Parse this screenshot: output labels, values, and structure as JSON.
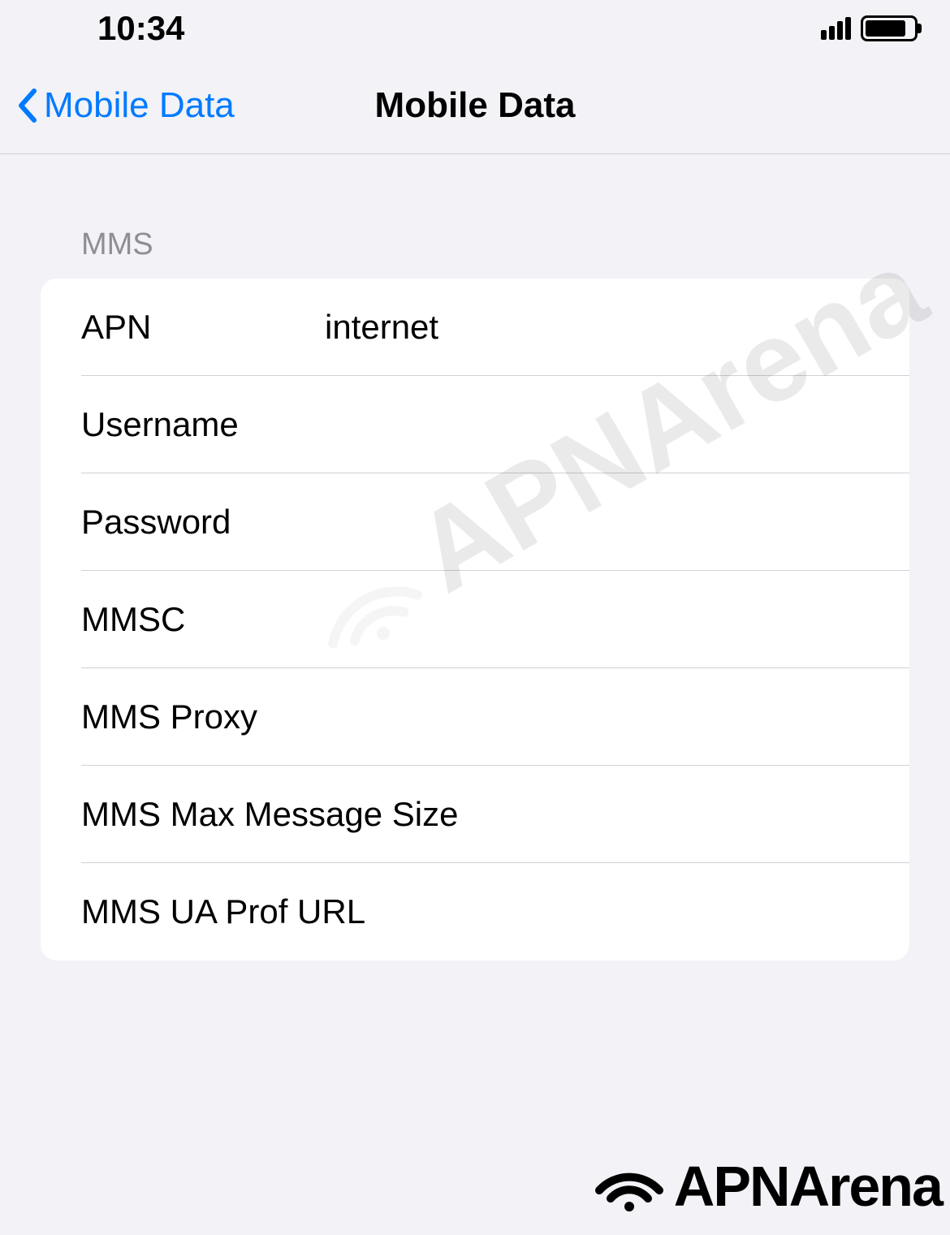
{
  "statusBar": {
    "time": "10:34"
  },
  "navBar": {
    "backLabel": "Mobile Data",
    "title": "Mobile Data"
  },
  "section": {
    "header": "MMS",
    "fields": {
      "apn": {
        "label": "APN",
        "value": "internet"
      },
      "username": {
        "label": "Username",
        "value": ""
      },
      "password": {
        "label": "Password",
        "value": ""
      },
      "mmsc": {
        "label": "MMSC",
        "value": ""
      },
      "mmsProxy": {
        "label": "MMS Proxy",
        "value": ""
      },
      "mmsMaxSize": {
        "label": "MMS Max Message Size",
        "value": ""
      },
      "mmsUaProf": {
        "label": "MMS UA Prof URL",
        "value": ""
      }
    }
  },
  "watermark": "APNArena",
  "footerLogo": "APNArena"
}
